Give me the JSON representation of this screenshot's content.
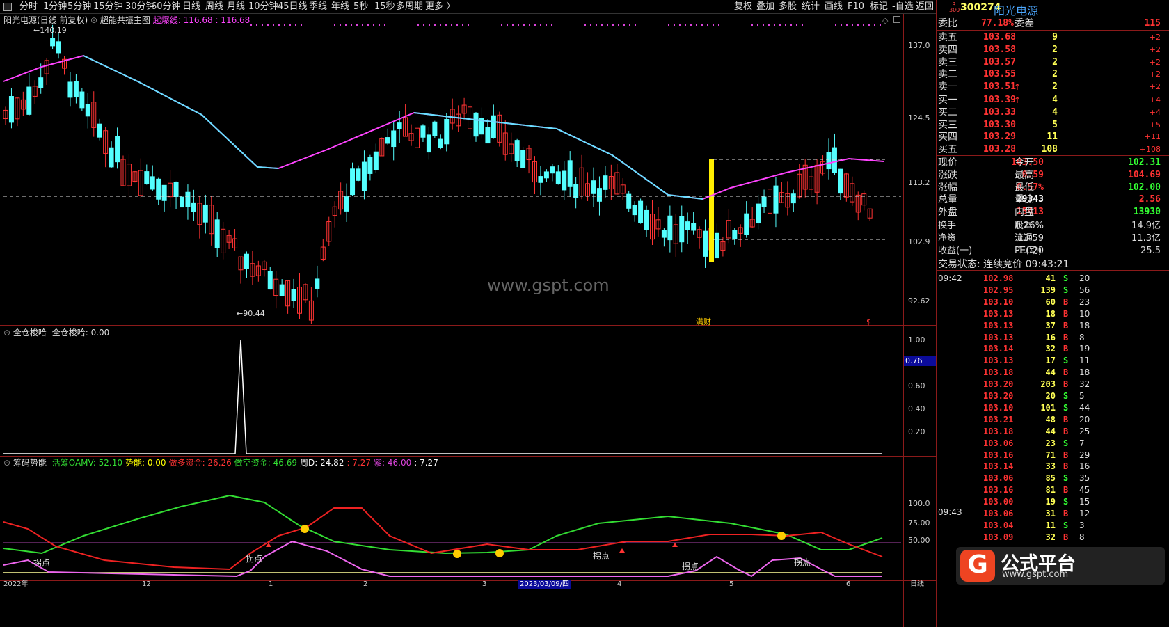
{
  "toolbar": {
    "left": [
      "分时",
      "1分钟",
      "5分钟",
      "15分钟",
      "30分钟",
      "60分钟",
      "日线",
      "周线",
      "月线",
      "10分钟",
      "45日线",
      "季线",
      "年线",
      "5秒",
      "15秒",
      "多周期",
      "更多 〉"
    ],
    "right": [
      "复权",
      "叠加",
      "多股",
      "统计",
      "画线",
      "F10",
      "标记",
      "-自选",
      "返回"
    ]
  },
  "main_panel": {
    "header_stock": "阳光电源(日线 前复权)",
    "header_indicator": "超能共振主图",
    "header_line_label": "起爆线:",
    "header_value1": "116.68",
    "header_value2": ": 116.68",
    "max_label": "140.19",
    "min_label": "90.44",
    "y_ticks": [
      "137.0",
      "124.5",
      "113.2",
      "102.9",
      "92.62"
    ],
    "watermark": "www.gspt.com",
    "marker_label": "满财",
    "dollar_mark": "$",
    "colors": {
      "up": "#ff3333",
      "down": "#54ffff",
      "ma_up": "#ff44ff",
      "ma_down": "#66e0ff",
      "highlight": "#ffee00"
    }
  },
  "ind1": {
    "title": "全仓梭哈",
    "label": "全仓梭哈: 0.00",
    "y_ticks": [
      "1.00",
      "0.60",
      "0.40",
      "0.20"
    ],
    "cursor_value": "0.76"
  },
  "ind2": {
    "title": "筹码势能",
    "items": [
      {
        "t": "活筹OAMV: 52.10",
        "c": "#33dd33"
      },
      {
        "t": "势能: 0.00",
        "c": "#ffff00"
      },
      {
        "t": "做多资金: 26.26",
        "c": "#ff3333"
      },
      {
        "t": "做空资金: 46.69",
        "c": "#33dd33"
      },
      {
        "t": "周D: 24.82",
        "c": "#ffffff"
      },
      {
        "t": ": 7.27",
        "c": "#ff3333"
      },
      {
        "t": "紫: 46.00",
        "c": "#dd44dd"
      },
      {
        "t": ": 7.27",
        "c": "#ffffff"
      }
    ],
    "y_ticks": [
      "100.0",
      "75.00",
      "50.00"
    ],
    "signal_label": "拐点"
  },
  "x_axis": {
    "labels": [
      "2022年",
      "12",
      "1",
      "2",
      "3",
      "4",
      "5",
      "6",
      "日线"
    ],
    "cursor_date": "2023/03/09/四"
  },
  "quote": {
    "badge_top": "R",
    "badge_bottom": "300",
    "code": "300274",
    "name": "阳光电源",
    "weibi_label": "委比",
    "weibi_value": "77.18%",
    "weicha_label": "委差",
    "weicha_value": "115",
    "asks": [
      {
        "label": "卖五",
        "price": "103.68",
        "vol": "9",
        "chg": "+2"
      },
      {
        "label": "卖四",
        "price": "103.58",
        "vol": "2",
        "chg": "+2"
      },
      {
        "label": "卖三",
        "price": "103.57",
        "vol": "2",
        "chg": "+2"
      },
      {
        "label": "卖二",
        "price": "103.55",
        "vol": "2",
        "chg": "+2"
      },
      {
        "label": "卖一",
        "price": "103.51",
        "vol": "2",
        "chg": "+2",
        "arrow": "↑"
      }
    ],
    "bids": [
      {
        "label": "买一",
        "price": "103.39",
        "vol": "4",
        "chg": "+4",
        "arrow": "↑"
      },
      {
        "label": "买二",
        "price": "103.33",
        "vol": "4",
        "chg": "+4"
      },
      {
        "label": "买三",
        "price": "103.30",
        "vol": "5",
        "chg": "+5"
      },
      {
        "label": "买四",
        "price": "103.29",
        "vol": "11",
        "chg": "+11"
      },
      {
        "label": "买五",
        "price": "103.28",
        "vol": "108",
        "chg": "+108"
      }
    ],
    "stats": [
      {
        "l1": "现价",
        "v1": "103.50",
        "c1": "#ff3333",
        "l2": "今开",
        "v2": "102.31",
        "c2": "#33ff33"
      },
      {
        "l1": "涨跌",
        "v1": "0.59",
        "c1": "#ff3333",
        "l2": "最高",
        "v2": "104.69",
        "c2": "#ff3333"
      },
      {
        "l1": "涨幅",
        "v1": "0.57%",
        "c1": "#ff3333",
        "l2": "最低",
        "v2": "102.00",
        "c2": "#33ff33"
      },
      {
        "l1": "总量",
        "v1": "29343",
        "c1": "#ffffff",
        "l2": "量比",
        "v2": "2.56",
        "c2": "#ff3333"
      },
      {
        "l1": "外盘",
        "v1": "15413",
        "c1": "#ff3333",
        "l2": "内盘",
        "v2": "13930",
        "c2": "#33ff33"
      }
    ],
    "stats2": [
      {
        "l1": "换手",
        "v1": "0.26%",
        "l2": "股本",
        "v2": "14.9亿"
      },
      {
        "l1": "净资",
        "v1": "13.59",
        "l2": "流通",
        "v2": "11.3亿"
      },
      {
        "l1": "收益(一)",
        "v1": "1.020",
        "l2": "PE(动)",
        "v2": "25.5"
      }
    ],
    "trade_status": "交易状态: 连续竞价 09:43:21",
    "ticks_time1": "09:42",
    "ticks_time2": "09:43",
    "ticks": [
      {
        "p": "102.98",
        "v": "41",
        "s": "S",
        "n": "20"
      },
      {
        "p": "102.95",
        "v": "139",
        "s": "S",
        "n": "56"
      },
      {
        "p": "103.10",
        "v": "60",
        "s": "B",
        "n": "23"
      },
      {
        "p": "103.13",
        "v": "18",
        "s": "B",
        "n": "10"
      },
      {
        "p": "103.13",
        "v": "37",
        "s": "B",
        "n": "18"
      },
      {
        "p": "103.13",
        "v": "16",
        "s": "B",
        "n": "8"
      },
      {
        "p": "103.14",
        "v": "32",
        "s": "B",
        "n": "19"
      },
      {
        "p": "103.13",
        "v": "17",
        "s": "S",
        "n": "11"
      },
      {
        "p": "103.18",
        "v": "44",
        "s": "B",
        "n": "18"
      },
      {
        "p": "103.20",
        "v": "203",
        "s": "B",
        "n": "32"
      },
      {
        "p": "103.20",
        "v": "20",
        "s": "S",
        "n": "5"
      },
      {
        "p": "103.10",
        "v": "101",
        "s": "S",
        "n": "44"
      },
      {
        "p": "103.21",
        "v": "48",
        "s": "B",
        "n": "20"
      },
      {
        "p": "103.18",
        "v": "44",
        "s": "B",
        "n": "25"
      },
      {
        "p": "103.06",
        "v": "23",
        "s": "S",
        "n": "7"
      },
      {
        "p": "103.16",
        "v": "71",
        "s": "B",
        "n": "29"
      },
      {
        "p": "103.14",
        "v": "33",
        "s": "B",
        "n": "16"
      },
      {
        "p": "103.06",
        "v": "85",
        "s": "S",
        "n": "35"
      },
      {
        "p": "103.16",
        "v": "81",
        "s": "B",
        "n": "45"
      },
      {
        "p": "103.00",
        "v": "19",
        "s": "S",
        "n": "15"
      },
      {
        "p": "103.06",
        "v": "31",
        "s": "B",
        "n": "12"
      },
      {
        "p": "103.04",
        "v": "11",
        "s": "S",
        "n": "3"
      },
      {
        "p": "103.09",
        "v": "32",
        "s": "B",
        "n": "8"
      }
    ]
  },
  "logo": {
    "name": "公式平台",
    "url": "www.gspt.com"
  }
}
